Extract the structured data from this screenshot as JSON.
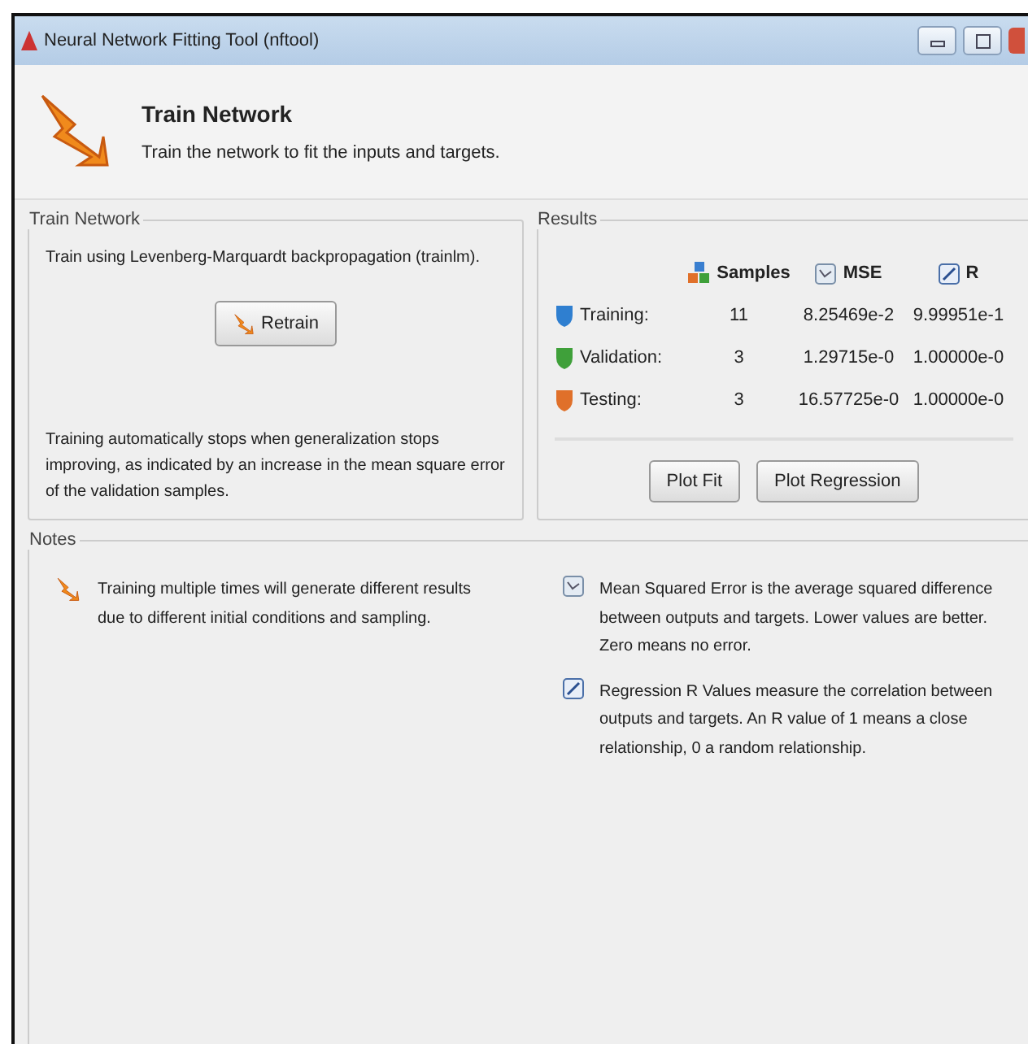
{
  "window": {
    "title": "Neural Network Fitting Tool (nftool)"
  },
  "header": {
    "title": "Train Network",
    "subtitle": "Train the network to fit the inputs and targets."
  },
  "train_panel": {
    "title": "Train Network",
    "description": "Train using Levenberg-Marquardt backpropagation (trainlm).",
    "button": "Retrain",
    "note": "Training automatically stops when generalization stops improving, as indicated by an increase in the mean square error of the validation samples."
  },
  "results": {
    "title": "Results",
    "columns": [
      {
        "label": "Samples",
        "kind": "samples"
      },
      {
        "label": "MSE",
        "kind": "mse"
      },
      {
        "label": "R",
        "kind": "r"
      }
    ],
    "rows": [
      {
        "label": "Training:",
        "color": "#2f7fd0",
        "cells": [
          "11",
          "8.25469e-2",
          "9.99951e-1"
        ]
      },
      {
        "label": "Validation:",
        "color": "#3fa03a",
        "cells": [
          "3",
          "1.29715e-0",
          "1.00000e-0"
        ]
      },
      {
        "label": "Testing:",
        "color": "#e0702a",
        "cells": [
          "3",
          "16.57725e-0",
          "1.00000e-0"
        ]
      }
    ],
    "buttons": [
      "Plot Fit",
      "Plot Regression"
    ]
  },
  "notes": {
    "title": "Notes",
    "items": [
      {
        "kind": "retrain",
        "text": "Training multiple times will generate different results due to different initial conditions and sampling."
      },
      {
        "kind": "mse",
        "text": "Mean Squared Error is the average squared difference between outputs and targets. Lower values are better. Zero means no error."
      },
      {
        "kind": "r",
        "text": "Regression R Values measure the correlation between outputs and targets. An R value of 1 means a close relationship, 0 a random relationship."
      }
    ]
  }
}
